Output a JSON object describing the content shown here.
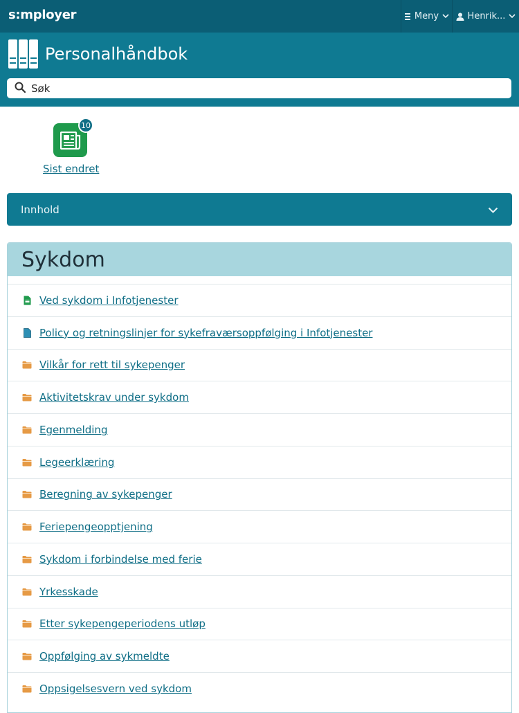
{
  "topbar": {
    "logo": "s:mployer",
    "menu_label": "Meny",
    "user_label": "Henrik..."
  },
  "header": {
    "title": "Personalhåndbok",
    "search_placeholder": "Søk"
  },
  "recent": {
    "label": "Sist endret",
    "count": "10"
  },
  "innhold": {
    "label": "Innhold"
  },
  "section": {
    "title": "Sykdom",
    "items": [
      {
        "label": "Ved sykdom i Infotjenester",
        "icon": "green-document-icon"
      },
      {
        "label": "Policy og retningslinjer for sykefraværsoppfølging i Infotjenester",
        "icon": "blue-document-icon"
      },
      {
        "label": "Vilkår for rett til sykepenger",
        "icon": "folder-icon"
      },
      {
        "label": "Aktivitetskrav under sykdom",
        "icon": "folder-icon"
      },
      {
        "label": "Egenmelding",
        "icon": "folder-icon"
      },
      {
        "label": "Legeerklæring",
        "icon": "folder-icon"
      },
      {
        "label": "Beregning av sykepenger",
        "icon": "folder-icon"
      },
      {
        "label": "Feriepengeopptjening",
        "icon": "folder-icon"
      },
      {
        "label": "Sykdom i forbindelse med ferie",
        "icon": "folder-icon"
      },
      {
        "label": "Yrkesskade",
        "icon": "folder-icon"
      },
      {
        "label": "Etter sykepengeperiodens utløp",
        "icon": "folder-icon"
      },
      {
        "label": "Oppfølging av sykmeldte",
        "icon": "folder-icon"
      },
      {
        "label": "Oppsigelsesvern ved sykdom",
        "icon": "folder-icon"
      }
    ]
  },
  "colors": {
    "topbar": "#0b5e75",
    "header": "#0f7a92",
    "link": "#0f6e86",
    "section_header": "#a8d6de",
    "folder": "#e69a45",
    "doc_green": "#1f9a4c",
    "doc_blue": "#2e8fb4"
  }
}
